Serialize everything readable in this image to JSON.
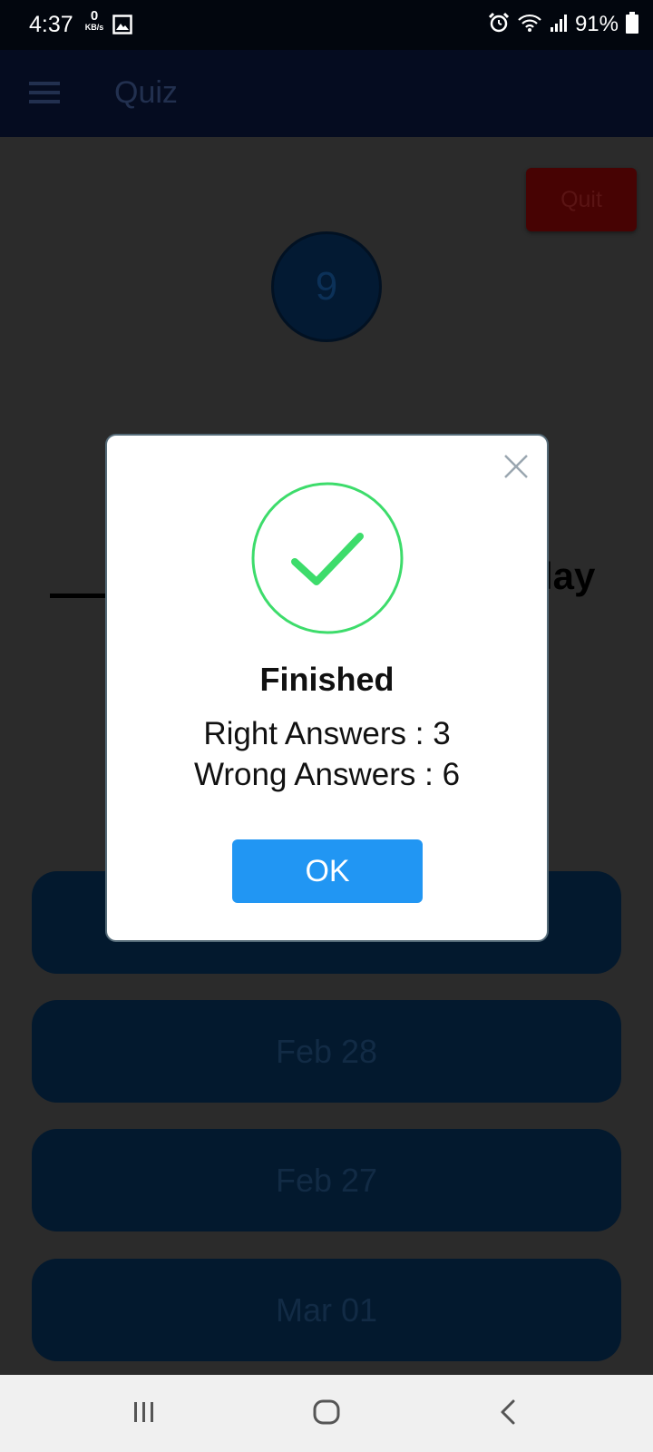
{
  "status_bar": {
    "time": "4:37",
    "net_speed_value": "0",
    "net_speed_unit": "KB/s",
    "battery_percent": "91%",
    "icons": [
      "gallery-icon",
      "alarm-icon",
      "wifi-icon",
      "signal-icon",
      "battery-icon"
    ]
  },
  "app_bar": {
    "title": "Quiz",
    "menu_icon": "hamburger-menu-icon"
  },
  "content": {
    "quit_label": "Quit",
    "question_number": "9",
    "question_fragment": "lay",
    "answers": [
      "Feb 28",
      "Feb 27",
      "Mar 01"
    ]
  },
  "dialog": {
    "title": "Finished",
    "right_answers": "Right Answers : 3",
    "wrong_answers": "Wrong Answers : 6",
    "ok_label": "OK",
    "icon": "checkmark-circle-icon",
    "accent_color": "#3ddc6b",
    "button_color": "#2196f3"
  },
  "nav_bar": {
    "icons": [
      "recent-apps-icon",
      "home-icon",
      "back-icon"
    ]
  }
}
